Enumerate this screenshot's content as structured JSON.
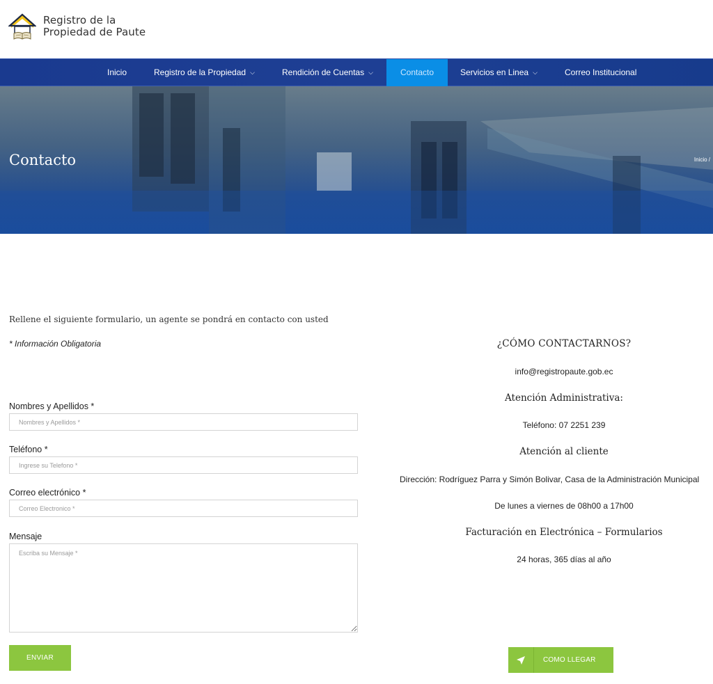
{
  "brand": {
    "line1": "Registro de la",
    "line2": "Propiedad de Paute"
  },
  "nav": {
    "items": [
      {
        "label": "Inicio",
        "dropdown": false
      },
      {
        "label": "Registro de la Propiedad",
        "dropdown": true
      },
      {
        "label": "Rendición de Cuentas",
        "dropdown": true
      },
      {
        "label": "Contacto",
        "dropdown": false,
        "active": true
      },
      {
        "label": "Servicios en Linea",
        "dropdown": true
      },
      {
        "label": "Correo Institucional",
        "dropdown": false
      }
    ]
  },
  "banner": {
    "title": "Contacto",
    "breadcrumb": "Inicio /"
  },
  "form": {
    "intro": "Rellene el siguiente formulario, un agente se pondrá en contacto con usted",
    "required_note": "* Información Obligatoria",
    "fields": [
      {
        "label": "Nombres y Apellidos *",
        "placeholder": "Nombres y Apellidos *",
        "value": ""
      },
      {
        "label": "Teléfono *",
        "placeholder": "Ingrese su Telefono *",
        "value": ""
      },
      {
        "label": "Correo electrónico *",
        "placeholder": "Correo Electronico *",
        "value": ""
      },
      {
        "label": "Mensaje",
        "placeholder": "Escriba su Mensaje *",
        "value": ""
      }
    ],
    "submit_label": "ENVIAR"
  },
  "contact": {
    "heading": "¿CÓMO CONTACTARNOS?",
    "email": "info@registropaute.gob.ec",
    "admin_title": "Atención Administrativa:",
    "phone": "Teléfono: 07 2251 239",
    "client_title": "Atención al cliente",
    "address": "Dirección: Rodríguez Parra y Simón Bolivar, Casa de la Administración Municipal",
    "hours": "De lunes a viernes de 08h00 a 17h00",
    "billing_title": "Facturación en Electrónica – Formularios",
    "billing_hours": "24 horas, 365 días al año",
    "map_button": "COMO LLEGAR"
  },
  "colors": {
    "nav_bg": "#1a3a8f",
    "nav_active": "#0a8ee6",
    "accent_green": "#8cc63f"
  },
  "icons": {
    "logo": "house-book-logo",
    "chevron": "chevron-down-icon",
    "map": "location-arrow-icon"
  }
}
